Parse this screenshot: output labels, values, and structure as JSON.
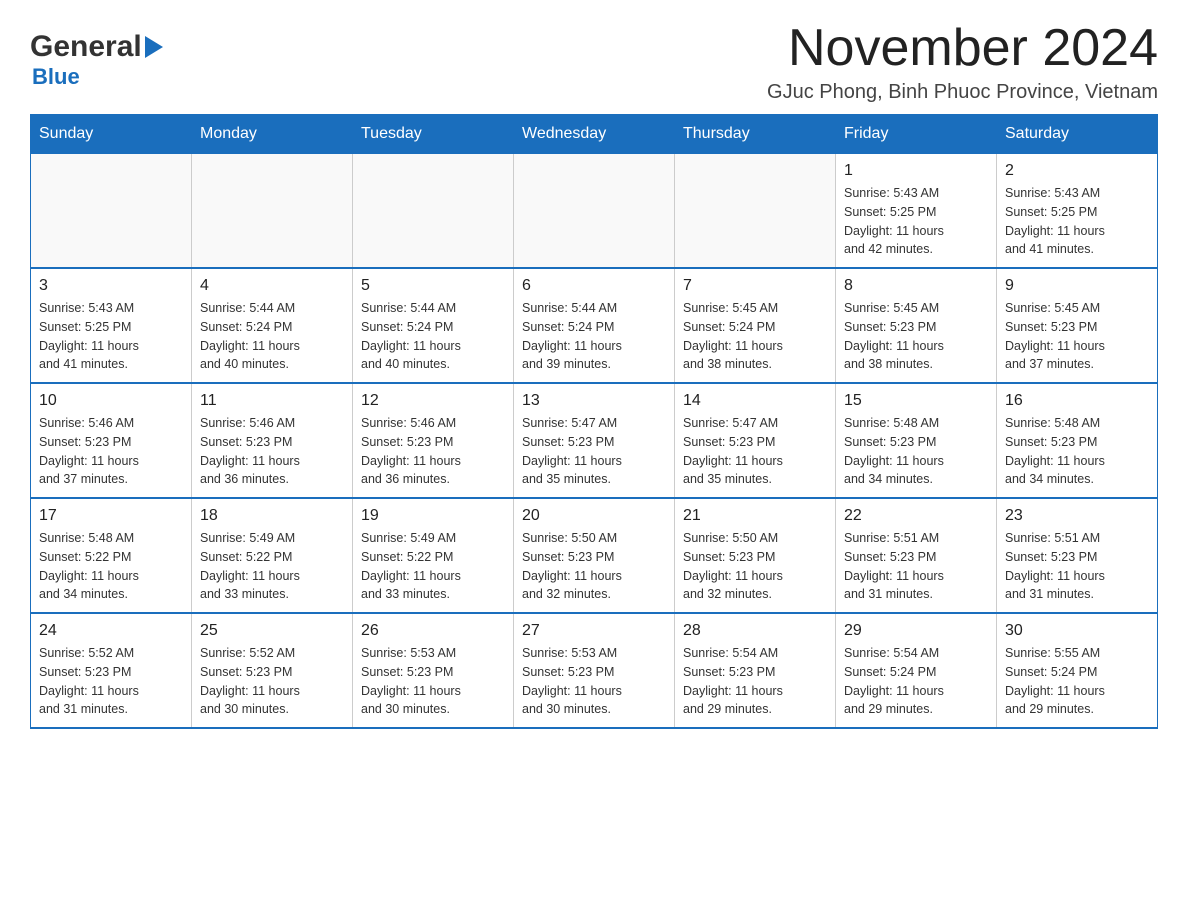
{
  "logo": {
    "line1": "General",
    "triangle": "▶",
    "line2": "Blue"
  },
  "title": "November 2024",
  "subtitle": "GJuc Phong, Binh Phuoc Province, Vietnam",
  "days_header": [
    "Sunday",
    "Monday",
    "Tuesday",
    "Wednesday",
    "Thursday",
    "Friday",
    "Saturday"
  ],
  "weeks": [
    [
      {
        "day": "",
        "info": ""
      },
      {
        "day": "",
        "info": ""
      },
      {
        "day": "",
        "info": ""
      },
      {
        "day": "",
        "info": ""
      },
      {
        "day": "",
        "info": ""
      },
      {
        "day": "1",
        "info": "Sunrise: 5:43 AM\nSunset: 5:25 PM\nDaylight: 11 hours\nand 42 minutes."
      },
      {
        "day": "2",
        "info": "Sunrise: 5:43 AM\nSunset: 5:25 PM\nDaylight: 11 hours\nand 41 minutes."
      }
    ],
    [
      {
        "day": "3",
        "info": "Sunrise: 5:43 AM\nSunset: 5:25 PM\nDaylight: 11 hours\nand 41 minutes."
      },
      {
        "day": "4",
        "info": "Sunrise: 5:44 AM\nSunset: 5:24 PM\nDaylight: 11 hours\nand 40 minutes."
      },
      {
        "day": "5",
        "info": "Sunrise: 5:44 AM\nSunset: 5:24 PM\nDaylight: 11 hours\nand 40 minutes."
      },
      {
        "day": "6",
        "info": "Sunrise: 5:44 AM\nSunset: 5:24 PM\nDaylight: 11 hours\nand 39 minutes."
      },
      {
        "day": "7",
        "info": "Sunrise: 5:45 AM\nSunset: 5:24 PM\nDaylight: 11 hours\nand 38 minutes."
      },
      {
        "day": "8",
        "info": "Sunrise: 5:45 AM\nSunset: 5:23 PM\nDaylight: 11 hours\nand 38 minutes."
      },
      {
        "day": "9",
        "info": "Sunrise: 5:45 AM\nSunset: 5:23 PM\nDaylight: 11 hours\nand 37 minutes."
      }
    ],
    [
      {
        "day": "10",
        "info": "Sunrise: 5:46 AM\nSunset: 5:23 PM\nDaylight: 11 hours\nand 37 minutes."
      },
      {
        "day": "11",
        "info": "Sunrise: 5:46 AM\nSunset: 5:23 PM\nDaylight: 11 hours\nand 36 minutes."
      },
      {
        "day": "12",
        "info": "Sunrise: 5:46 AM\nSunset: 5:23 PM\nDaylight: 11 hours\nand 36 minutes."
      },
      {
        "day": "13",
        "info": "Sunrise: 5:47 AM\nSunset: 5:23 PM\nDaylight: 11 hours\nand 35 minutes."
      },
      {
        "day": "14",
        "info": "Sunrise: 5:47 AM\nSunset: 5:23 PM\nDaylight: 11 hours\nand 35 minutes."
      },
      {
        "day": "15",
        "info": "Sunrise: 5:48 AM\nSunset: 5:23 PM\nDaylight: 11 hours\nand 34 minutes."
      },
      {
        "day": "16",
        "info": "Sunrise: 5:48 AM\nSunset: 5:23 PM\nDaylight: 11 hours\nand 34 minutes."
      }
    ],
    [
      {
        "day": "17",
        "info": "Sunrise: 5:48 AM\nSunset: 5:22 PM\nDaylight: 11 hours\nand 34 minutes."
      },
      {
        "day": "18",
        "info": "Sunrise: 5:49 AM\nSunset: 5:22 PM\nDaylight: 11 hours\nand 33 minutes."
      },
      {
        "day": "19",
        "info": "Sunrise: 5:49 AM\nSunset: 5:22 PM\nDaylight: 11 hours\nand 33 minutes."
      },
      {
        "day": "20",
        "info": "Sunrise: 5:50 AM\nSunset: 5:23 PM\nDaylight: 11 hours\nand 32 minutes."
      },
      {
        "day": "21",
        "info": "Sunrise: 5:50 AM\nSunset: 5:23 PM\nDaylight: 11 hours\nand 32 minutes."
      },
      {
        "day": "22",
        "info": "Sunrise: 5:51 AM\nSunset: 5:23 PM\nDaylight: 11 hours\nand 31 minutes."
      },
      {
        "day": "23",
        "info": "Sunrise: 5:51 AM\nSunset: 5:23 PM\nDaylight: 11 hours\nand 31 minutes."
      }
    ],
    [
      {
        "day": "24",
        "info": "Sunrise: 5:52 AM\nSunset: 5:23 PM\nDaylight: 11 hours\nand 31 minutes."
      },
      {
        "day": "25",
        "info": "Sunrise: 5:52 AM\nSunset: 5:23 PM\nDaylight: 11 hours\nand 30 minutes."
      },
      {
        "day": "26",
        "info": "Sunrise: 5:53 AM\nSunset: 5:23 PM\nDaylight: 11 hours\nand 30 minutes."
      },
      {
        "day": "27",
        "info": "Sunrise: 5:53 AM\nSunset: 5:23 PM\nDaylight: 11 hours\nand 30 minutes."
      },
      {
        "day": "28",
        "info": "Sunrise: 5:54 AM\nSunset: 5:23 PM\nDaylight: 11 hours\nand 29 minutes."
      },
      {
        "day": "29",
        "info": "Sunrise: 5:54 AM\nSunset: 5:24 PM\nDaylight: 11 hours\nand 29 minutes."
      },
      {
        "day": "30",
        "info": "Sunrise: 5:55 AM\nSunset: 5:24 PM\nDaylight: 11 hours\nand 29 minutes."
      }
    ]
  ]
}
